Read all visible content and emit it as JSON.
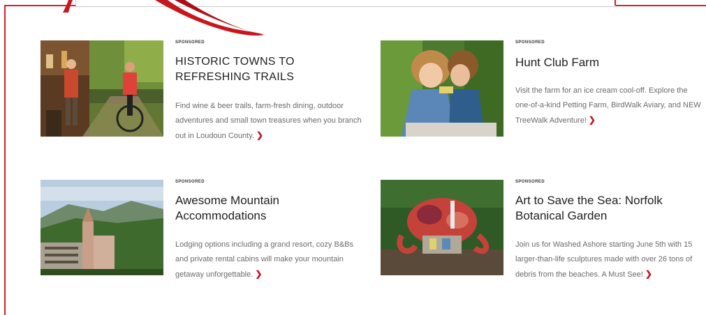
{
  "cards": [
    {
      "tag": "SPONSORED",
      "title": "HISTORIC TOWNS TO REFRESHING TRAILS",
      "desc": "Find wine & beer trails, farm-fresh dining, outdoor adventures and small town treasures when you branch out in Loudoun County.",
      "more_icon": "chevron-right-icon"
    },
    {
      "tag": "SPONSORED",
      "title": "Hunt Club Farm",
      "desc": "Visit the farm for an ice cream cool-off. Explore the one-of-a-kind Petting Farm, BirdWalk Aviary, and NEW TreeWalk Adventure!",
      "more_icon": "chevron-right-icon"
    },
    {
      "tag": "SPONSORED",
      "title": "Awesome Mountain Accommodations",
      "desc": "Lodging options including a grand resort, cozy B&Bs and private rental cabins will make your mountain getaway unforgettable.",
      "more_icon": "chevron-right-icon"
    },
    {
      "tag": "SPONSORED",
      "title": "Art to Save the Sea: Norfolk Botanical Garden",
      "desc": "Join us for Washed Ashore starting June 5th with 15 larger-than-life sculptures made with over 26 tons of debris from the beaches. A Must See!",
      "more_icon": "chevron-right-icon"
    }
  ],
  "colors": {
    "accent": "#c4152b",
    "frame": "#d0202e"
  }
}
